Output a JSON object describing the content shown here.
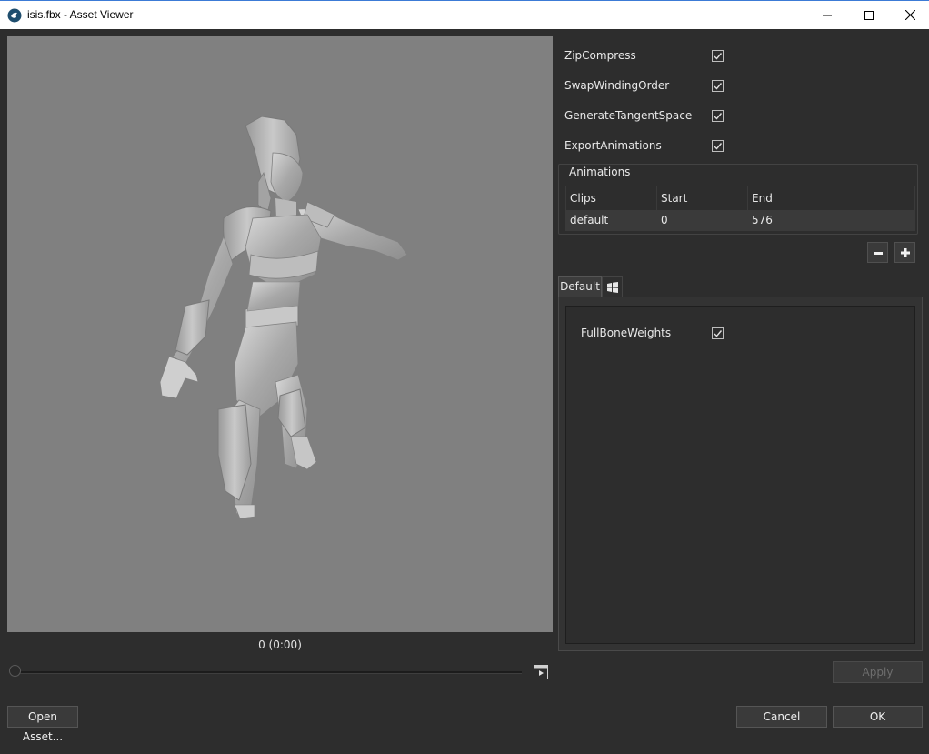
{
  "window": {
    "title": "isis.fbx - Asset Viewer",
    "minimize_glyph": "—",
    "maximize_glyph": "☐",
    "close_glyph": "✕"
  },
  "viewer": {
    "frame_label": "0 (0:00)",
    "timeline_position": 0
  },
  "properties": [
    {
      "label": "ZipCompress",
      "checked": true
    },
    {
      "label": "SwapWindingOrder",
      "checked": true
    },
    {
      "label": "GenerateTangentSpace",
      "checked": true
    },
    {
      "label": "ExportAnimations",
      "checked": true
    }
  ],
  "animations": {
    "group_title": "Animations",
    "columns": [
      "Clips",
      "Start",
      "End"
    ],
    "rows": [
      {
        "clip": "default",
        "start": "0",
        "end": "576"
      }
    ]
  },
  "tabs": {
    "default_label": "Default",
    "windows_icon": "windows-icon"
  },
  "platform_settings": [
    {
      "label": "FullBoneWeights",
      "checked": true
    }
  ],
  "buttons": {
    "apply": "Apply",
    "open_asset": "Open Asset...",
    "cancel": "Cancel",
    "ok": "OK"
  },
  "colors": {
    "background": "#2d2d2d",
    "viewport": "#808080",
    "titlebar": "#ffffff"
  }
}
